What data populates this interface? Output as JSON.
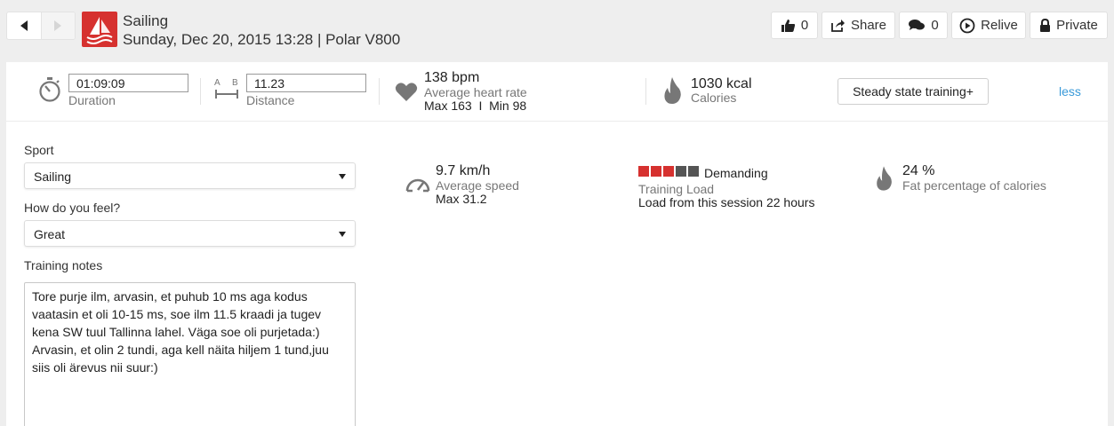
{
  "header": {
    "sport": "Sailing",
    "subtitle": "Sunday, Dec 20, 2015 13:28 | Polar V800",
    "like_count": "0",
    "share_label": "Share",
    "comment_count": "0",
    "relive_label": "Relive",
    "privacy_label": "Private"
  },
  "summary": {
    "duration_value": "01:09:09",
    "duration_label": "Duration",
    "distance_value": "11.23",
    "distance_label": "Distance",
    "distance_icon_a": "A",
    "distance_icon_b": "B",
    "heart_rate_value": "138 bpm",
    "heart_rate_label": "Average heart rate",
    "heart_rate_minmax": "Max 163  I  Min 98",
    "calories_value": "1030 kcal",
    "calories_label": "Calories",
    "benefit_button": "Steady state training+",
    "less_link": "less"
  },
  "form": {
    "sport_label": "Sport",
    "sport_value": "Sailing",
    "feel_label": "How do you feel?",
    "feel_value": "Great",
    "notes_label": "Training notes",
    "notes_value": "Tore purje ilm, arvasin, et puhub 10 ms aga kodus vaatasin et oli 10-15 ms, soe ilm 11.5 kraadi ja tugev kena SW tuul Tallinna lahel. Väga soe oli purjetada:) Arvasin, et olin 2 tundi, aga kell näita hiljem 1 tund,juu siis oli ärevus nii suur:)"
  },
  "stats": {
    "speed_value": "9.7 km/h",
    "speed_label": "Average speed",
    "speed_max": "Max 31.2",
    "load_level": "Demanding",
    "load_label": "Training Load",
    "load_detail": "Load from this session 22 hours",
    "load_filled": 3,
    "load_total": 5,
    "fat_value": "24 %",
    "fat_label": "Fat percentage of calories"
  },
  "colors": {
    "brand_red": "#d6312f",
    "link_blue": "#3a9ad9",
    "icon_grey": "#777777",
    "load_empty": "#555555"
  }
}
